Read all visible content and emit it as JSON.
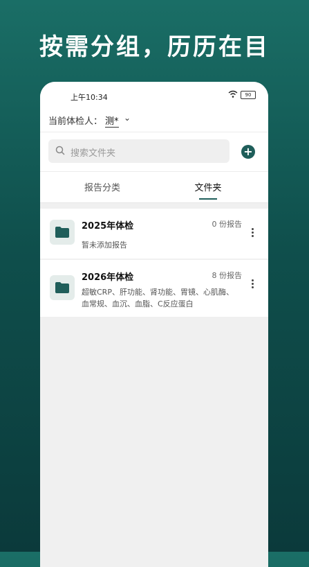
{
  "headline": "按需分组，历历在目",
  "status_bar": {
    "time": "上午10:34",
    "battery": "90"
  },
  "person": {
    "label": "当前体检人：",
    "name": "测*"
  },
  "search": {
    "placeholder": "搜索文件夹"
  },
  "tabs": [
    {
      "label": "报告分类"
    },
    {
      "label": "文件夹"
    }
  ],
  "folders": [
    {
      "title": "2025年体检",
      "count": "0 份报告",
      "desc": "暂未添加报告"
    },
    {
      "title": "2026年体检",
      "count": "8 份报告",
      "desc": "超敏CRP、肝功能、肾功能、胃镜、心肌酶、血常规、血沉、血脂、C反应蛋白"
    }
  ],
  "colors": {
    "accent": "#1f5e5a",
    "background_top": "#1a6e66",
    "background_bottom": "#0b3a3b"
  },
  "icons": [
    "search-icon",
    "plus-icon",
    "folder-icon",
    "more-icon",
    "wifi-icon",
    "battery-icon",
    "chevron-down-icon"
  ]
}
